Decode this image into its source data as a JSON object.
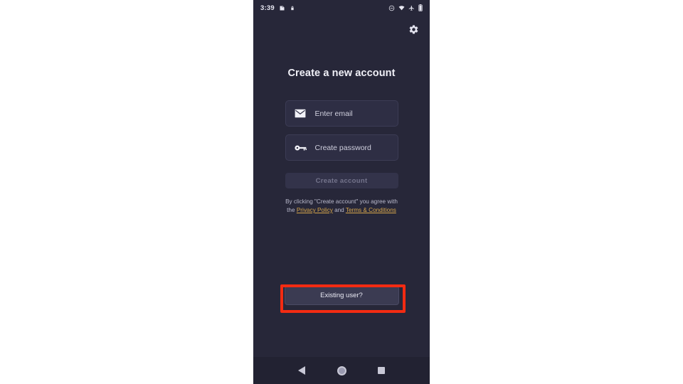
{
  "device": {
    "status_bar": {
      "clock": "3:39",
      "left_icons": [
        "sd-card-icon",
        "lock-icon"
      ],
      "right_icons": [
        "do-not-disturb-icon",
        "wifi-icon",
        "airplane-mode-icon",
        "battery-icon"
      ]
    },
    "nav_bar": {
      "back_label": "Back",
      "home_label": "Home",
      "recents_label": "Recent apps"
    }
  },
  "screen": {
    "settings_icon": "gear-icon",
    "title": "Create a new account",
    "fields": [
      {
        "name": "email",
        "icon": "envelope-icon",
        "placeholder": "Enter email",
        "value": ""
      },
      {
        "name": "password",
        "icon": "key-icon",
        "placeholder": "Create password",
        "value": ""
      }
    ],
    "primary_button": {
      "label": "Create account",
      "enabled": false
    },
    "legal": {
      "prefix": "By clicking \"Create account\" you agree with the ",
      "link_privacy": "Privacy Policy",
      "conjunction": " and ",
      "link_terms": "Terms & Conditions"
    },
    "secondary_button": {
      "label": "Existing user?"
    }
  },
  "annotation": {
    "highlight_target": "Existing user?",
    "highlight_color": "#f32b12"
  },
  "colors": {
    "background": "#272739",
    "field_background": "#2e2e44",
    "link": "#d9a84b",
    "button_secondary": "#3b3b52",
    "nav_bar": "#222232"
  }
}
